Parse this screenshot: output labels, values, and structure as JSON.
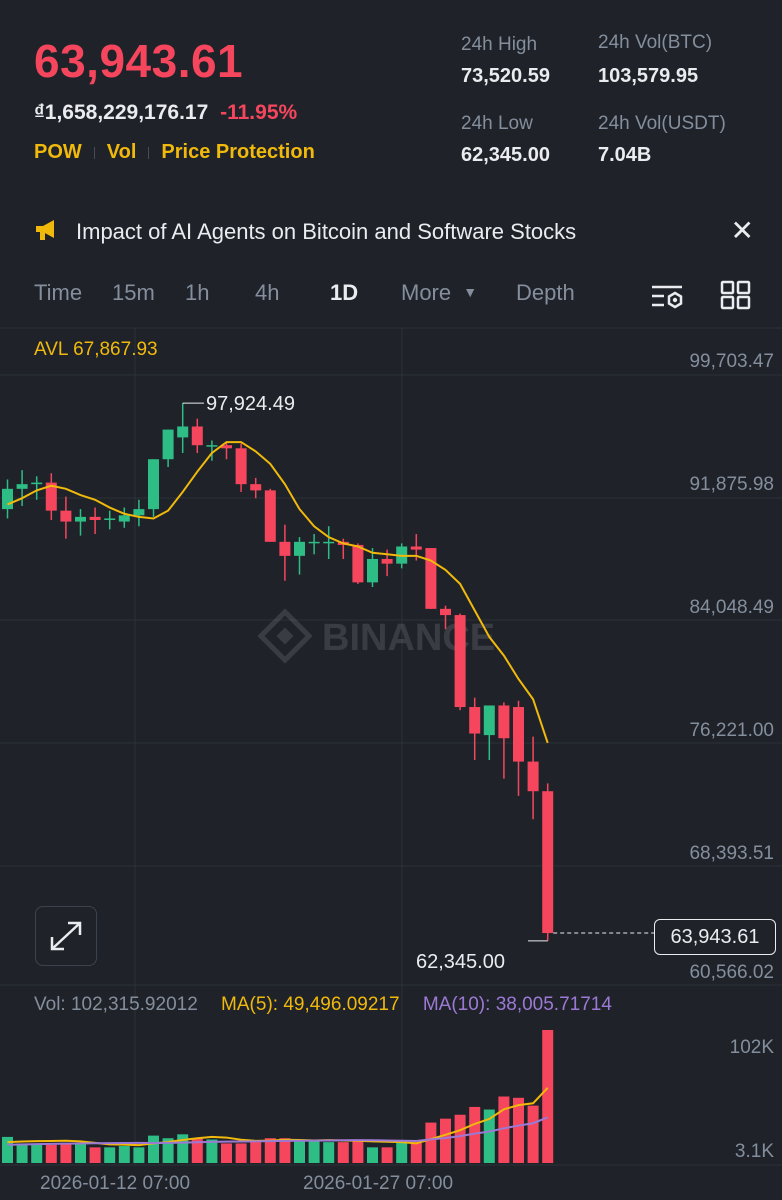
{
  "header": {
    "last_price": "63,943.61",
    "fiat_price": "₫1,658,229,176.17",
    "change_percent": "-11.95%",
    "tags": [
      "POW",
      "Vol",
      "Price Protection"
    ],
    "stats": {
      "high_label": "24h High",
      "high_value": "73,520.59",
      "vol_btc_label": "24h Vol(BTC)",
      "vol_btc_value": "103,579.95",
      "low_label": "24h Low",
      "low_value": "62,345.00",
      "vol_usdt_label": "24h Vol(USDT)",
      "vol_usdt_value": "7.04B"
    }
  },
  "news": {
    "text": "Impact of AI Agents on Bitcoin and Software Stocks",
    "icon": "megaphone-icon",
    "close_icon": "close-icon"
  },
  "tabs": {
    "time": "Time",
    "m15": "15m",
    "h1": "1h",
    "h4": "4h",
    "d1": "1D",
    "more": "More",
    "depth": "Depth",
    "active": "1D"
  },
  "chart": {
    "avl_label": "AVL 67,867.93",
    "watermark": "BINANCE",
    "y_axis": [
      "99,703.47",
      "91,875.98",
      "84,048.49",
      "76,221.00",
      "68,393.51",
      "60,566.02"
    ],
    "high_marker": "97,924.49",
    "low_marker": "62,345.00",
    "current_price_tag": "63,943.61",
    "vol_label": "Vol: 102,315.92012",
    "ma5_label": "MA(5): 49,496.09217",
    "ma10_label": "MA(10): 38,005.71714",
    "vol_axis_top": "102K",
    "vol_axis_bottom": "3.1K",
    "dates": [
      "2026-01-12 07:00",
      "2026-01-27 07:00"
    ]
  },
  "colors": {
    "up": "#2ebd85",
    "down": "#f6465d",
    "accent": "#f0b90b",
    "ma10": "#9d79d6"
  },
  "chart_data": {
    "type": "candlestick",
    "y_range": [
      60566.02,
      99703.47
    ],
    "candles": [
      {
        "o": 91100,
        "h": 93000,
        "l": 90500,
        "c": 92400
      },
      {
        "o": 92400,
        "h": 93600,
        "l": 91300,
        "c": 92700
      },
      {
        "o": 92700,
        "h": 93200,
        "l": 91700,
        "c": 92800
      },
      {
        "o": 92800,
        "h": 93400,
        "l": 90400,
        "c": 91000
      },
      {
        "o": 91000,
        "h": 91900,
        "l": 89200,
        "c": 90300
      },
      {
        "o": 90300,
        "h": 91100,
        "l": 89400,
        "c": 90600
      },
      {
        "o": 90600,
        "h": 91200,
        "l": 89500,
        "c": 90400
      },
      {
        "o": 90400,
        "h": 91000,
        "l": 89800,
        "c": 90500
      },
      {
        "o": 90300,
        "h": 91200,
        "l": 89900,
        "c": 90700
      },
      {
        "o": 90700,
        "h": 91700,
        "l": 90000,
        "c": 91100
      },
      {
        "o": 91100,
        "h": 94300,
        "l": 90600,
        "c": 94300
      },
      {
        "o": 94300,
        "h": 96200,
        "l": 93800,
        "c": 96200
      },
      {
        "o": 95700,
        "h": 97900,
        "l": 94700,
        "c": 96400
      },
      {
        "o": 96400,
        "h": 96900,
        "l": 94700,
        "c": 95200
      },
      {
        "o": 95200,
        "h": 95500,
        "l": 94200,
        "c": 95200
      },
      {
        "o": 95200,
        "h": 95400,
        "l": 94300,
        "c": 95000
      },
      {
        "o": 95000,
        "h": 95300,
        "l": 92200,
        "c": 92700
      },
      {
        "o": 92700,
        "h": 93100,
        "l": 91800,
        "c": 92300
      },
      {
        "o": 92300,
        "h": 92400,
        "l": 89000,
        "c": 89000
      },
      {
        "o": 89000,
        "h": 90100,
        "l": 86500,
        "c": 88100
      },
      {
        "o": 88100,
        "h": 89300,
        "l": 86900,
        "c": 89000
      },
      {
        "o": 89000,
        "h": 89500,
        "l": 88200,
        "c": 89000
      },
      {
        "o": 89000,
        "h": 90000,
        "l": 87900,
        "c": 89000
      },
      {
        "o": 89000,
        "h": 89200,
        "l": 87900,
        "c": 88800
      },
      {
        "o": 88800,
        "h": 88900,
        "l": 86300,
        "c": 86400
      },
      {
        "o": 86400,
        "h": 88600,
        "l": 86100,
        "c": 87900
      },
      {
        "o": 87900,
        "h": 88500,
        "l": 86800,
        "c": 87600
      },
      {
        "o": 87600,
        "h": 88900,
        "l": 87300,
        "c": 88700
      },
      {
        "o": 88700,
        "h": 89500,
        "l": 87800,
        "c": 88500
      },
      {
        "o": 88600,
        "h": 88600,
        "l": 84700,
        "c": 84700
      },
      {
        "o": 84700,
        "h": 84900,
        "l": 83400,
        "c": 84300
      },
      {
        "o": 84300,
        "h": 84400,
        "l": 78200,
        "c": 78400
      },
      {
        "o": 78400,
        "h": 79000,
        "l": 75000,
        "c": 76700
      },
      {
        "o": 76600,
        "h": 78500,
        "l": 75000,
        "c": 78500
      },
      {
        "o": 78500,
        "h": 78700,
        "l": 73800,
        "c": 76400
      },
      {
        "o": 78400,
        "h": 78800,
        "l": 72700,
        "c": 74900
      },
      {
        "o": 74900,
        "h": 76500,
        "l": 71200,
        "c": 73000
      },
      {
        "o": 73000,
        "h": 73500,
        "l": 63400,
        "c": 63900
      }
    ],
    "ma": [
      91400,
      91800,
      92300,
      92600,
      92400,
      92000,
      91700,
      91200,
      90800,
      90600,
      90500,
      91000,
      92200,
      93500,
      94700,
      95400,
      95400,
      94800,
      94000,
      92700,
      91100,
      90000,
      89300,
      88900,
      88700,
      88300,
      88200,
      88100,
      88100,
      87800,
      87200,
      86300,
      84600,
      82900,
      81700,
      80200,
      78900,
      76100
    ],
    "volume": [
      20000,
      15000,
      14000,
      14000,
      15000,
      15000,
      12000,
      12000,
      13000,
      12000,
      21000,
      19000,
      22000,
      19000,
      18000,
      15000,
      15000,
      17000,
      19000,
      19000,
      18000,
      18000,
      16000,
      16000,
      17000,
      12000,
      12000,
      17000,
      16000,
      31000,
      34000,
      37000,
      43000,
      41000,
      51000,
      50000,
      44000,
      102000
    ],
    "vol_ma5": [
      16000,
      16500,
      16800,
      16900,
      17100,
      16600,
      15400,
      14300,
      14100,
      13700,
      15000,
      16100,
      17600,
      19000,
      20000,
      19500,
      17800,
      17000,
      17200,
      17800,
      17600,
      17300,
      17500,
      17300,
      17100,
      16600,
      16300,
      16000,
      15100,
      18300,
      21600,
      25200,
      30000,
      33800,
      41200,
      44400,
      45800,
      57700
    ],
    "vol_ma10": [
      14000,
      14200,
      14500,
      14700,
      14900,
      15000,
      15100,
      15200,
      15300,
      15400,
      15300,
      15400,
      15600,
      15900,
      16200,
      16400,
      16500,
      16600,
      16800,
      17000,
      17100,
      17200,
      17300,
      17400,
      17500,
      17400,
      17300,
      17100,
      16900,
      18100,
      19200,
      20600,
      22500,
      24100,
      26600,
      28700,
      30500,
      35000
    ]
  }
}
